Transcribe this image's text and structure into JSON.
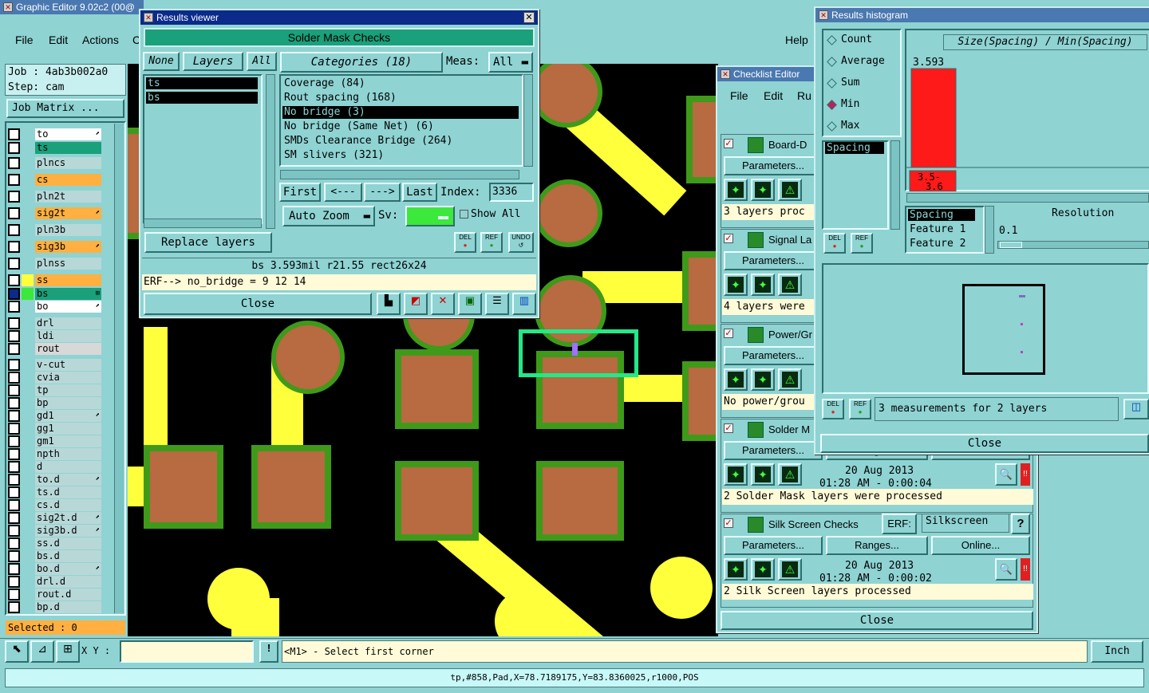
{
  "main_window": {
    "title": "Graphic Editor 9.02c2 (00@",
    "menu": [
      "File",
      "Edit",
      "Actions",
      "C",
      "Help"
    ],
    "job_label": "Job : 4ab3b002a0",
    "step_label": "Step: cam",
    "job_matrix": "Job Matrix ...",
    "layers": [
      {
        "name": "to",
        "color": "#ffffff",
        "flag": "⬈"
      },
      {
        "name": "ts",
        "color": "#1aa07a",
        "flag": ""
      },
      {
        "name": "plncs",
        "color": "#b8d8d8",
        "flag": ""
      },
      {
        "name": "cs",
        "color": "#ffb040",
        "flag": ""
      },
      {
        "name": "pln2t",
        "color": "#b8d8d8",
        "flag": ""
      },
      {
        "name": "sig2t",
        "color": "#ffb040",
        "flag": "⬈"
      },
      {
        "name": "pln3b",
        "color": "#b8d8d8",
        "flag": ""
      },
      {
        "name": "sig3b",
        "color": "#ffb040",
        "flag": "⬈"
      },
      {
        "name": "plnss",
        "color": "#b8d8d8",
        "flag": ""
      },
      {
        "name": "ss",
        "color": "#ffb040",
        "flag": ""
      },
      {
        "name": "bs",
        "color": "#1aa07a",
        "flag": "⊞"
      },
      {
        "name": "bo",
        "color": "#ffffff",
        "flag": "⬈"
      },
      {
        "name": "drl",
        "color": "#b8d8d8",
        "flag": ""
      },
      {
        "name": "ldi",
        "color": "#b8d8d8",
        "flag": ""
      },
      {
        "name": "rout",
        "color": "#d8d8d8",
        "flag": ""
      },
      {
        "name": "v-cut",
        "color": "#b8d8d8",
        "flag": ""
      },
      {
        "name": "cvia",
        "color": "#b8d8d8",
        "flag": ""
      },
      {
        "name": "tp",
        "color": "#b8d8d8",
        "flag": ""
      },
      {
        "name": "bp",
        "color": "#b8d8d8",
        "flag": ""
      },
      {
        "name": "gd1",
        "color": "#b8d8d8",
        "flag": "⬈"
      },
      {
        "name": "gg1",
        "color": "#b8d8d8",
        "flag": ""
      },
      {
        "name": "gm1",
        "color": "#b8d8d8",
        "flag": ""
      },
      {
        "name": "npth",
        "color": "#b8d8d8",
        "flag": ""
      },
      {
        "name": "d",
        "color": "#b8d8d8",
        "flag": ""
      },
      {
        "name": "to.d",
        "color": "#b8d8d8",
        "flag": "⬈"
      },
      {
        "name": "ts.d",
        "color": "#b8d8d8",
        "flag": ""
      },
      {
        "name": "cs.d",
        "color": "#b8d8d8",
        "flag": ""
      },
      {
        "name": "sig2t.d",
        "color": "#b8d8d8",
        "flag": "⬈"
      },
      {
        "name": "sig3b.d",
        "color": "#b8d8d8",
        "flag": "⬈"
      },
      {
        "name": "ss.d",
        "color": "#b8d8d8",
        "flag": ""
      },
      {
        "name": "bs.d",
        "color": "#b8d8d8",
        "flag": ""
      },
      {
        "name": "bo.d",
        "color": "#b8d8d8",
        "flag": "⬈"
      },
      {
        "name": "drl.d",
        "color": "#b8d8d8",
        "flag": ""
      },
      {
        "name": "rout.d",
        "color": "#b8d8d8",
        "flag": ""
      },
      {
        "name": "bp.d",
        "color": "#b8d8d8",
        "flag": ""
      }
    ],
    "selected": "Selected : 0",
    "xy_label": "X Y :",
    "xy_value": "",
    "prompt": "<M1> - Select first corner",
    "units": "Inch",
    "status": "tp,#858,Pad,X=78.7189175,Y=83.8360025,r1000,POS"
  },
  "results_viewer": {
    "title": "Results viewer",
    "header": "Solder Mask Checks",
    "none_btn": "None",
    "layers_btn": "Layers",
    "all_btn": "All",
    "layers": [
      "ts",
      "bs"
    ],
    "categories_label": "Categories (18)",
    "meas_label": "Meas:",
    "meas_value": "All",
    "categories": [
      "Coverage (84)",
      "Rout spacing (168)",
      "No bridge (3)",
      "No bridge (Same Net) (6)",
      "SMDs Clearance Bridge (264)",
      "SM slivers (321)"
    ],
    "selected_category": "No bridge (3)",
    "first": "First",
    "prev": "<---",
    "next": "--->",
    "last": "Last",
    "index_label": "Index:",
    "index_value": "3336",
    "auto_zoom": "Auto Zoom",
    "sv_label": "Sv:",
    "show_all": "Show All",
    "replace_layers": "Replace layers",
    "del": "DEL",
    "ref": "REF",
    "undo": "UNDO",
    "measure_line": "bs 3.593mil   r21.55   rect26x24",
    "erf_line": "ERF--> no_bridge = 9 12 14",
    "close": "Close"
  },
  "checklist_editor": {
    "title": "Checklist Editor",
    "menu": [
      "File",
      "Edit",
      "Ru"
    ],
    "parameters": "Parameters...",
    "ranges": "Ranges...",
    "online": "Online...",
    "erf": "ERF:",
    "items": [
      {
        "name": "Board-D",
        "status": "3 layers proc"
      },
      {
        "name": "Signal La",
        "status": "4 layers were"
      },
      {
        "name": "Power/Gr",
        "status": "No power/grou"
      },
      {
        "name": "Solder M",
        "date": "20 Aug 2013",
        "time": "01:28 AM - 0:00:04",
        "status": "2 Solder Mask layers were processed"
      },
      {
        "name": "Silk Screen Checks",
        "erf_value": "Silkscreen",
        "date": "20 Aug 2013",
        "time": "01:28 AM - 0:00:02",
        "status": "2 Silk Screen layers processed"
      }
    ],
    "help": "?",
    "close": "Close"
  },
  "histogram": {
    "title": "Results histogram",
    "modes": [
      "Count",
      "Average",
      "Sum",
      "Min",
      "Max"
    ],
    "selected_mode": "Min",
    "title_expr": "Size(Spacing) / Min(Spacing)",
    "bar_value": "3.593",
    "bin_label": "3.5- 3.6",
    "list_left": [
      "Spacing"
    ],
    "list_right": [
      "Spacing",
      "Feature 1",
      "Feature 2"
    ],
    "resolution_label": "Resolution",
    "resolution_value": "0.1",
    "del": "DEL",
    "ref": "REF",
    "summary": "3 measurements for 2 layers",
    "close": "Close",
    "chart_data": {
      "type": "bar",
      "categories": [
        "3.5- 3.6"
      ],
      "values": [
        3.593
      ],
      "title": "Size(Spacing) / Min(Spacing)"
    }
  }
}
